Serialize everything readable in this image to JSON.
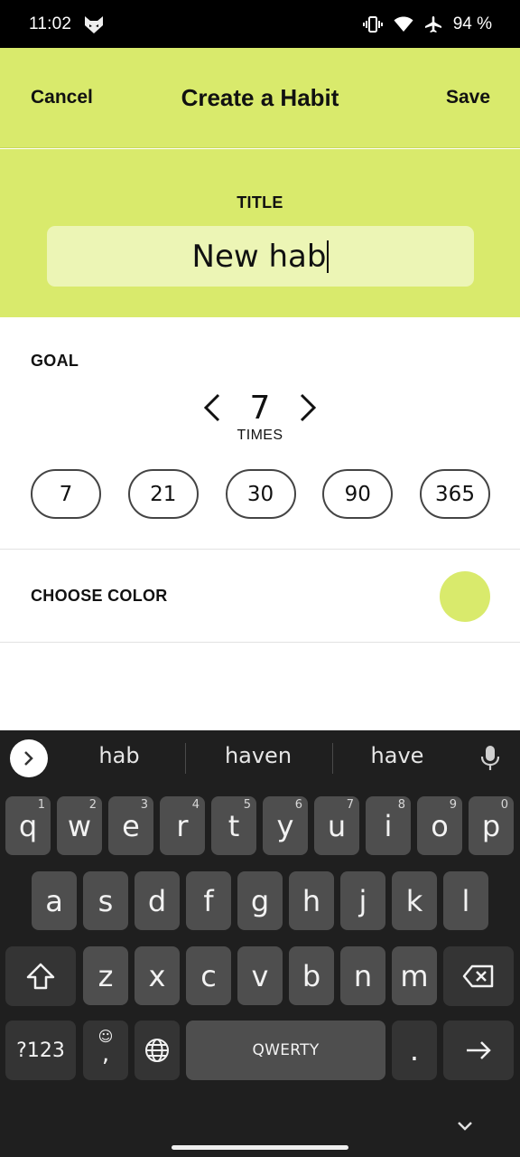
{
  "status_bar": {
    "time": "11:02",
    "battery": "94 %"
  },
  "header": {
    "cancel_label": "Cancel",
    "title": "Create a Habit",
    "save_label": "Save"
  },
  "title_section": {
    "label": "TITLE",
    "value": "New hab"
  },
  "goal_section": {
    "label": "GOAL",
    "value": "7",
    "unit": "TIMES",
    "presets": [
      "7",
      "21",
      "30",
      "90",
      "365"
    ]
  },
  "color_section": {
    "label": "CHOOSE COLOR",
    "selected_color": "#d9ea6c"
  },
  "keyboard": {
    "suggestions": [
      "hab",
      "haven",
      "have"
    ],
    "row1": [
      {
        "key": "q",
        "hint": "1"
      },
      {
        "key": "w",
        "hint": "2"
      },
      {
        "key": "e",
        "hint": "3"
      },
      {
        "key": "r",
        "hint": "4"
      },
      {
        "key": "t",
        "hint": "5"
      },
      {
        "key": "y",
        "hint": "6"
      },
      {
        "key": "u",
        "hint": "7"
      },
      {
        "key": "i",
        "hint": "8"
      },
      {
        "key": "o",
        "hint": "9"
      },
      {
        "key": "p",
        "hint": "0"
      }
    ],
    "row2": [
      "a",
      "s",
      "d",
      "f",
      "g",
      "h",
      "j",
      "k",
      "l"
    ],
    "row3": [
      "z",
      "x",
      "c",
      "v",
      "b",
      "n",
      "m"
    ],
    "symbols_label": "?123",
    "comma_label": ",",
    "space_label": "QWERTY",
    "period_label": "."
  },
  "colors": {
    "accent": "#d9ea6c",
    "accent_light": "#ecf5b5",
    "keyboard_bg": "#1f1f1f",
    "key_bg": "#4e4e4e"
  }
}
